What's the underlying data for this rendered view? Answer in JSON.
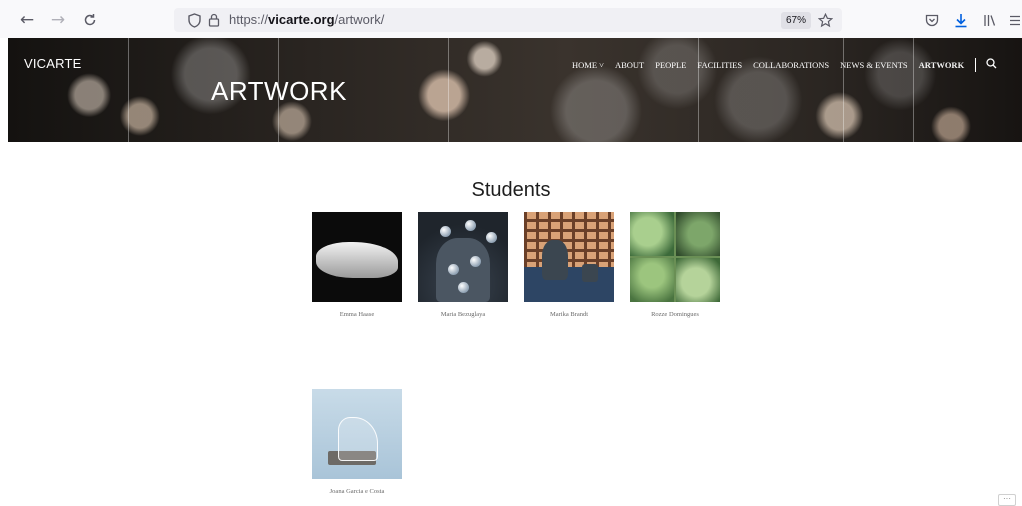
{
  "browser": {
    "url_prefix": "https://",
    "url_domain": "vicarte.org",
    "url_path": "/artwork/",
    "zoom": "67%"
  },
  "site": {
    "logo": "VICARTE",
    "page_heading": "ARTWORK",
    "nav": [
      {
        "label": "HOME ˅",
        "active": false
      },
      {
        "label": "ABOUT",
        "active": false
      },
      {
        "label": "PEOPLE",
        "active": false
      },
      {
        "label": "FACILITIES",
        "active": false
      },
      {
        "label": "COLLABORATIONS",
        "active": false
      },
      {
        "label": "NEWS & EVENTS",
        "active": false
      },
      {
        "label": "ARTWORK",
        "active": true
      }
    ]
  },
  "main": {
    "section_title": "Students",
    "students": [
      {
        "name": "Emma Haase"
      },
      {
        "name": "Maria Bezuglaya"
      },
      {
        "name": "Marika Brandt"
      },
      {
        "name": "Rozze Domingues"
      },
      {
        "name": "Joana Garcia e Costa"
      }
    ]
  },
  "icons": {
    "back": "back-arrow-icon",
    "forward": "forward-arrow-icon",
    "reload": "reload-icon",
    "shield": "tracking-shield-icon",
    "lock": "lock-icon",
    "star": "bookmark-star-icon",
    "pocket": "pocket-icon",
    "download": "download-icon",
    "library": "library-icon",
    "menu": "hamburger-menu-icon",
    "search": "search-icon"
  },
  "colors": {
    "toolbar_bg": "#f9f9fb",
    "download_accent": "#0060df"
  }
}
